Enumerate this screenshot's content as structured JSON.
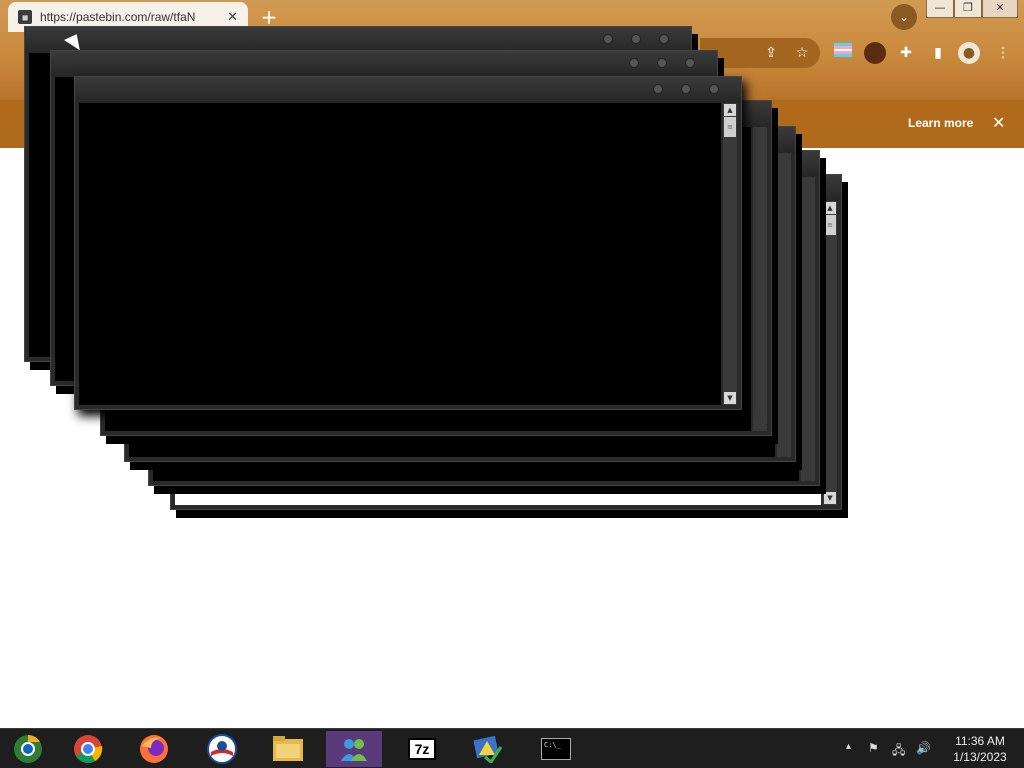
{
  "browser": {
    "tab_title": "https://pastebin.com/raw/tfaN",
    "tab_close": "✕",
    "new_tab": "+",
    "tab_search": "⌄",
    "minimize": "—",
    "restore": "❐",
    "close": "✕",
    "infobar": {
      "learn_more": "Learn more",
      "close": "✕"
    }
  },
  "taskbar": {
    "items": [
      {
        "name": "chrome-canary-taskbar-icon"
      },
      {
        "name": "chrome-taskbar-icon"
      },
      {
        "name": "firefox-taskbar-icon"
      },
      {
        "name": "obama-logo-taskbar-icon"
      },
      {
        "name": "file-explorer-taskbar-icon"
      },
      {
        "name": "messenger-taskbar-icon",
        "active": true
      },
      {
        "name": "7zip-taskbar-icon",
        "label": "7z"
      },
      {
        "name": "program-warning-taskbar-icon"
      },
      {
        "name": "command-prompt-taskbar-icon",
        "label": "C:\\_"
      }
    ],
    "tray": {
      "show_hidden": "▴"
    },
    "clock": {
      "time": "11:36 AM",
      "date": "1/13/2023"
    }
  },
  "colors": {
    "browser_frame": "#c98a3d",
    "infobar": "#b06a1c",
    "spam_window_frame": "#2a2a2a",
    "taskbar": "#1e1e1e"
  }
}
